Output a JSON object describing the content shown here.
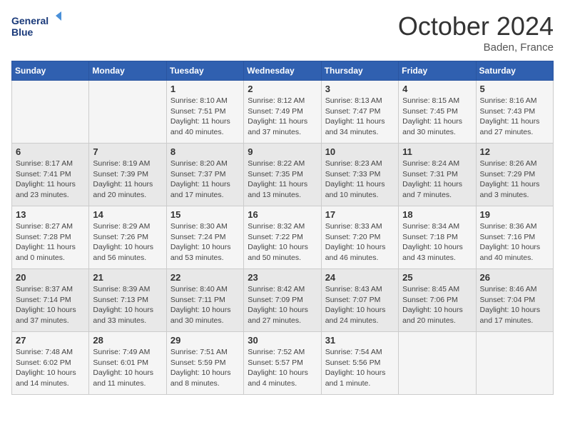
{
  "header": {
    "logo_line1": "General",
    "logo_line2": "Blue",
    "month": "October 2024",
    "location": "Baden, France"
  },
  "weekdays": [
    "Sunday",
    "Monday",
    "Tuesday",
    "Wednesday",
    "Thursday",
    "Friday",
    "Saturday"
  ],
  "weeks": [
    [
      {
        "day": "",
        "info": ""
      },
      {
        "day": "",
        "info": ""
      },
      {
        "day": "1",
        "info": "Sunrise: 8:10 AM\nSunset: 7:51 PM\nDaylight: 11 hours and 40 minutes."
      },
      {
        "day": "2",
        "info": "Sunrise: 8:12 AM\nSunset: 7:49 PM\nDaylight: 11 hours and 37 minutes."
      },
      {
        "day": "3",
        "info": "Sunrise: 8:13 AM\nSunset: 7:47 PM\nDaylight: 11 hours and 34 minutes."
      },
      {
        "day": "4",
        "info": "Sunrise: 8:15 AM\nSunset: 7:45 PM\nDaylight: 11 hours and 30 minutes."
      },
      {
        "day": "5",
        "info": "Sunrise: 8:16 AM\nSunset: 7:43 PM\nDaylight: 11 hours and 27 minutes."
      }
    ],
    [
      {
        "day": "6",
        "info": "Sunrise: 8:17 AM\nSunset: 7:41 PM\nDaylight: 11 hours and 23 minutes."
      },
      {
        "day": "7",
        "info": "Sunrise: 8:19 AM\nSunset: 7:39 PM\nDaylight: 11 hours and 20 minutes."
      },
      {
        "day": "8",
        "info": "Sunrise: 8:20 AM\nSunset: 7:37 PM\nDaylight: 11 hours and 17 minutes."
      },
      {
        "day": "9",
        "info": "Sunrise: 8:22 AM\nSunset: 7:35 PM\nDaylight: 11 hours and 13 minutes."
      },
      {
        "day": "10",
        "info": "Sunrise: 8:23 AM\nSunset: 7:33 PM\nDaylight: 11 hours and 10 minutes."
      },
      {
        "day": "11",
        "info": "Sunrise: 8:24 AM\nSunset: 7:31 PM\nDaylight: 11 hours and 7 minutes."
      },
      {
        "day": "12",
        "info": "Sunrise: 8:26 AM\nSunset: 7:29 PM\nDaylight: 11 hours and 3 minutes."
      }
    ],
    [
      {
        "day": "13",
        "info": "Sunrise: 8:27 AM\nSunset: 7:28 PM\nDaylight: 11 hours and 0 minutes."
      },
      {
        "day": "14",
        "info": "Sunrise: 8:29 AM\nSunset: 7:26 PM\nDaylight: 10 hours and 56 minutes."
      },
      {
        "day": "15",
        "info": "Sunrise: 8:30 AM\nSunset: 7:24 PM\nDaylight: 10 hours and 53 minutes."
      },
      {
        "day": "16",
        "info": "Sunrise: 8:32 AM\nSunset: 7:22 PM\nDaylight: 10 hours and 50 minutes."
      },
      {
        "day": "17",
        "info": "Sunrise: 8:33 AM\nSunset: 7:20 PM\nDaylight: 10 hours and 46 minutes."
      },
      {
        "day": "18",
        "info": "Sunrise: 8:34 AM\nSunset: 7:18 PM\nDaylight: 10 hours and 43 minutes."
      },
      {
        "day": "19",
        "info": "Sunrise: 8:36 AM\nSunset: 7:16 PM\nDaylight: 10 hours and 40 minutes."
      }
    ],
    [
      {
        "day": "20",
        "info": "Sunrise: 8:37 AM\nSunset: 7:14 PM\nDaylight: 10 hours and 37 minutes."
      },
      {
        "day": "21",
        "info": "Sunrise: 8:39 AM\nSunset: 7:13 PM\nDaylight: 10 hours and 33 minutes."
      },
      {
        "day": "22",
        "info": "Sunrise: 8:40 AM\nSunset: 7:11 PM\nDaylight: 10 hours and 30 minutes."
      },
      {
        "day": "23",
        "info": "Sunrise: 8:42 AM\nSunset: 7:09 PM\nDaylight: 10 hours and 27 minutes."
      },
      {
        "day": "24",
        "info": "Sunrise: 8:43 AM\nSunset: 7:07 PM\nDaylight: 10 hours and 24 minutes."
      },
      {
        "day": "25",
        "info": "Sunrise: 8:45 AM\nSunset: 7:06 PM\nDaylight: 10 hours and 20 minutes."
      },
      {
        "day": "26",
        "info": "Sunrise: 8:46 AM\nSunset: 7:04 PM\nDaylight: 10 hours and 17 minutes."
      }
    ],
    [
      {
        "day": "27",
        "info": "Sunrise: 7:48 AM\nSunset: 6:02 PM\nDaylight: 10 hours and 14 minutes."
      },
      {
        "day": "28",
        "info": "Sunrise: 7:49 AM\nSunset: 6:01 PM\nDaylight: 10 hours and 11 minutes."
      },
      {
        "day": "29",
        "info": "Sunrise: 7:51 AM\nSunset: 5:59 PM\nDaylight: 10 hours and 8 minutes."
      },
      {
        "day": "30",
        "info": "Sunrise: 7:52 AM\nSunset: 5:57 PM\nDaylight: 10 hours and 4 minutes."
      },
      {
        "day": "31",
        "info": "Sunrise: 7:54 AM\nSunset: 5:56 PM\nDaylight: 10 hours and 1 minute."
      },
      {
        "day": "",
        "info": ""
      },
      {
        "day": "",
        "info": ""
      }
    ]
  ]
}
